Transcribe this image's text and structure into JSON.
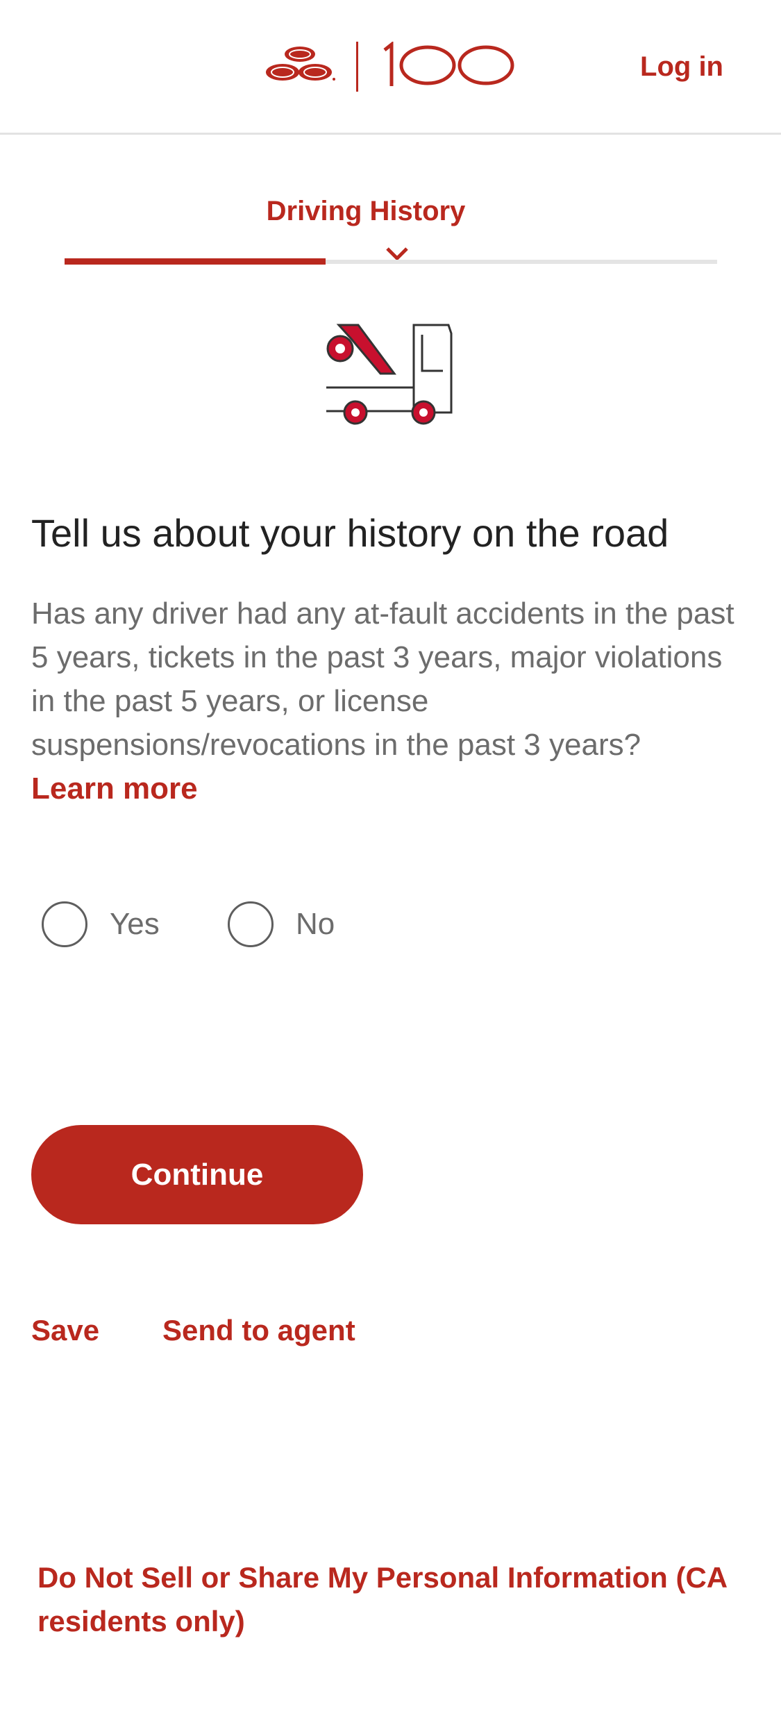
{
  "header": {
    "logo_text": "100",
    "login_label": "Log in"
  },
  "step": {
    "title": "Driving History",
    "progress_fraction": 0.4
  },
  "question": {
    "heading": "Tell us about your history on the road",
    "description": "Has any driver had any at-fault accidents in the past 5 years, tickets in the past 3 years, major violations in the past 5 years, or license suspensions/revocations in the past 3 years?",
    "learn_more": "Learn more",
    "options": [
      "Yes",
      "No"
    ]
  },
  "actions": {
    "continue_label": "Continue",
    "save_label": "Save",
    "send_label": "Send to agent"
  },
  "footer": {
    "privacy_link": "Do Not Sell or Share My Personal Information (CA residents only)"
  },
  "colors": {
    "brand": "#b9281e",
    "text": "#222222",
    "muted": "#6c6c6c"
  },
  "icons": {
    "logo": "three-ovals-logo",
    "illustration": "tow-truck-icon",
    "step_marker": "chevron-down-icon"
  }
}
